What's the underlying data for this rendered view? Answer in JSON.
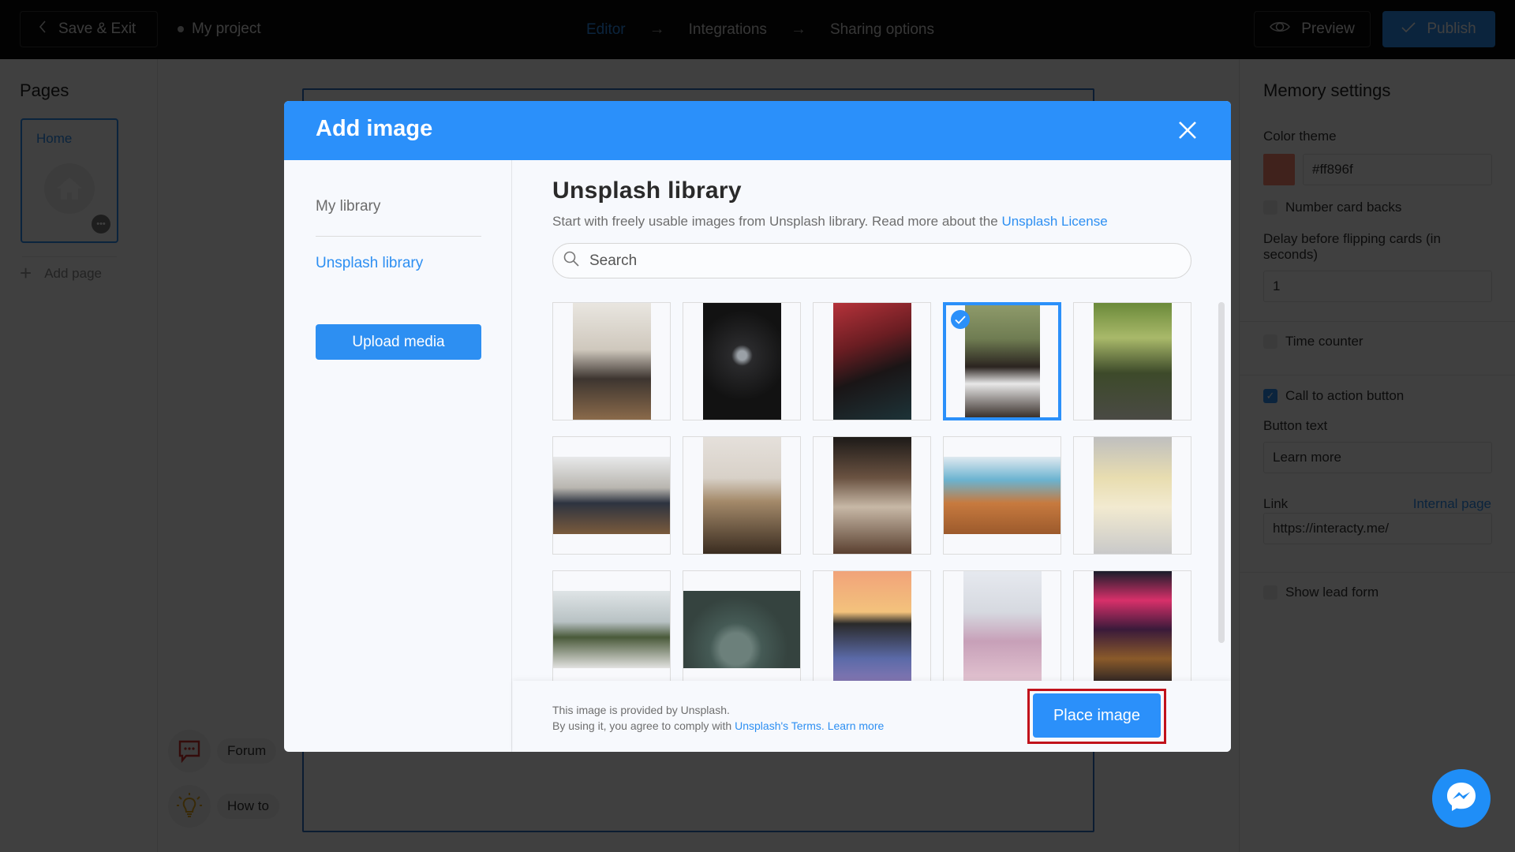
{
  "topbar": {
    "save_exit_label": "Save & Exit",
    "project_name": "My project",
    "steps": [
      {
        "label": "Editor",
        "active": true
      },
      {
        "label": "Integrations",
        "active": false
      },
      {
        "label": "Sharing options",
        "active": false
      }
    ],
    "preview_label": "Preview",
    "publish_label": "Publish"
  },
  "left_panel": {
    "title": "Pages",
    "pages": [
      {
        "name": "Home"
      }
    ],
    "add_page_label": "Add page"
  },
  "help": {
    "forum_label": "Forum",
    "howto_label": "How to"
  },
  "right_panel": {
    "title": "Memory settings",
    "color_theme_label": "Color theme",
    "color_theme_value": "#ff896f",
    "number_card_backs_label": "Number card backs",
    "number_card_backs_checked": false,
    "delay_label": "Delay before flipping cards (in seconds)",
    "delay_value": "1",
    "time_counter_label": "Time counter",
    "time_counter_checked": false,
    "cta_label": "Call to action button",
    "cta_checked": true,
    "button_text_label": "Button text",
    "button_text_value": "Learn more",
    "link_label": "Link",
    "internal_page_label": "Internal page",
    "link_value": "https://interacty.me/",
    "lead_form_label": "Show lead form",
    "lead_form_checked": false
  },
  "modal": {
    "title": "Add image",
    "nav": {
      "my_library": "My library",
      "unsplash_library": "Unsplash library",
      "active": "unsplash_library"
    },
    "upload_label": "Upload media",
    "library_title": "Unsplash library",
    "description": "Start with freely usable images from Unsplash library. Read more about the ",
    "license_link": "Unsplash License",
    "search_placeholder": "Search",
    "search_value": "",
    "images": [
      {
        "name": "people-at-desk-loft",
        "orientation": "portrait",
        "selected": false
      },
      {
        "name": "dark-tunnel",
        "orientation": "portrait",
        "selected": false
      },
      {
        "name": "woman-sunglasses-red",
        "orientation": "portrait",
        "selected": false
      },
      {
        "name": "man-studded-jacket",
        "orientation": "portrait",
        "selected": true
      },
      {
        "name": "forest-road-walkers",
        "orientation": "portrait",
        "selected": false
      },
      {
        "name": "man-laptop-window",
        "orientation": "landscape",
        "selected": false
      },
      {
        "name": "field-lone-tree",
        "orientation": "portrait",
        "selected": false
      },
      {
        "name": "woman-hair-tattoo",
        "orientation": "portrait",
        "selected": false
      },
      {
        "name": "beach-cliffs",
        "orientation": "landscape",
        "selected": false
      },
      {
        "name": "dessert-glasses",
        "orientation": "portrait",
        "selected": false
      },
      {
        "name": "office-plants",
        "orientation": "landscape",
        "selected": false
      },
      {
        "name": "abstract-green-waves",
        "orientation": "landscape",
        "selected": false
      },
      {
        "name": "man-sunglasses-sunset",
        "orientation": "portrait",
        "selected": false
      },
      {
        "name": "woman-yoga-rooftop",
        "orientation": "portrait",
        "selected": false
      },
      {
        "name": "neon-city-street",
        "orientation": "portrait",
        "selected": false
      }
    ],
    "footer": {
      "line1": "This image is provided by Unsplash.",
      "line2": "By using it, you agree to comply with ",
      "terms_link": "Unsplash's Terms.",
      "learn_more_link": "Learn more"
    },
    "place_label": "Place image"
  },
  "colors": {
    "accent": "#2b90fa",
    "highlight_outline": "#c1121b",
    "messenger": "#1f8ef7"
  }
}
